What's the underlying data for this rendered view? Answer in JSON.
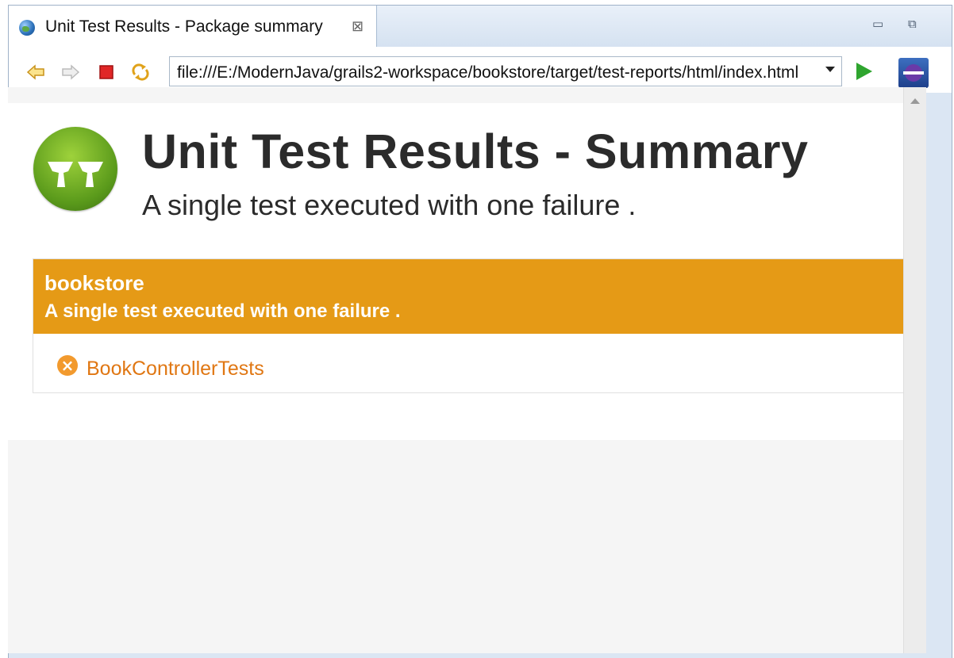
{
  "tab": {
    "title": "Unit Test Results - Package summary",
    "close_glyph": "⊠"
  },
  "window": {
    "minimize_glyph": "▭",
    "restore_glyph": "⧉"
  },
  "toolbar": {
    "back_icon": "back-arrow-icon",
    "forward_icon": "forward-arrow-icon",
    "stop_icon": "stop-icon",
    "refresh_icon": "refresh-icon",
    "url": "file:///E:/ModernJava/grails2-workspace/bookstore/target/test-reports/html/index.html",
    "go_icon": "go-icon",
    "browser_icon": "eclipse-browser-icon"
  },
  "report": {
    "title": "Unit Test Results - Summary",
    "subtitle": "A single test executed with one failure .",
    "package": {
      "name": "bookstore",
      "summary": "A single test executed with one failure .",
      "tests": [
        {
          "name": "BookControllerTests",
          "status": "failure"
        }
      ]
    }
  },
  "colors": {
    "accent": "#e59a16",
    "link": "#e07713",
    "title": "#2b2b2b",
    "logo_green": "#6aa61f"
  }
}
